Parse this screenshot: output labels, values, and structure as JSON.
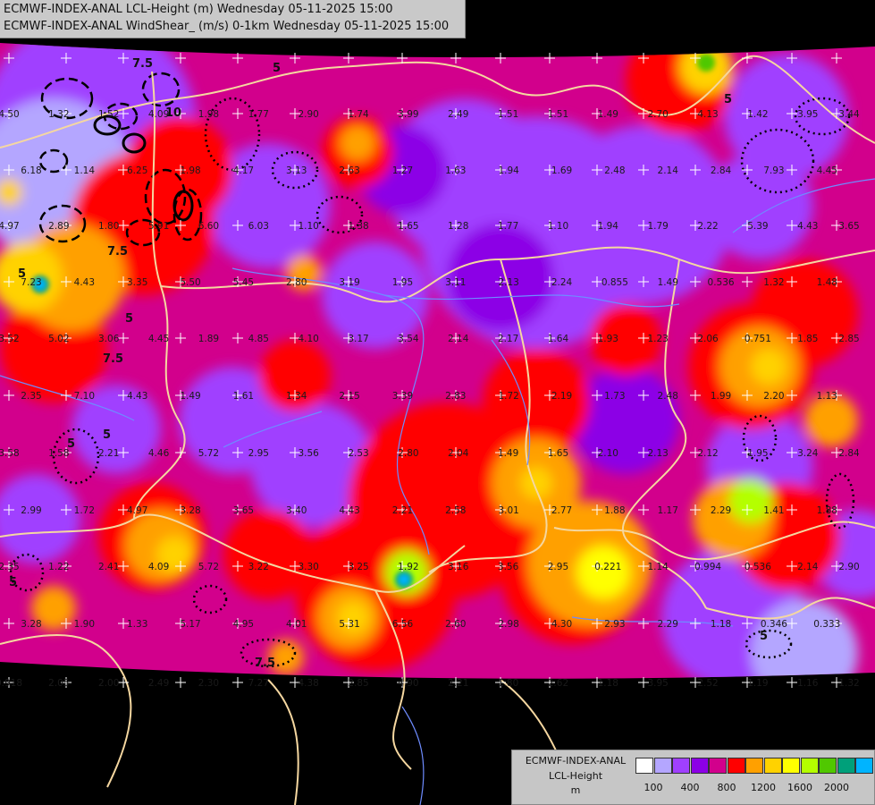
{
  "header": {
    "line1": "ECMWF-INDEX-ANAL LCL-Height (m) Wednesday 05-11-2025 15:00",
    "line2": "ECMWF-INDEX-ANAL WindShear_ (m/s) 0-1km Wednesday 05-11-2025 15:00"
  },
  "legend": {
    "title1": "ECMWF-INDEX-ANAL",
    "title2": "LCL-Height",
    "title3": "m",
    "colors": [
      "#ffffff",
      "#b4a6ff",
      "#a040ff",
      "#8c00e6",
      "#d2008c",
      "#ff0000",
      "#ffa000",
      "#ffd200",
      "#ffff00",
      "#b4ff00",
      "#50c800",
      "#00a07a",
      "#00b4ff"
    ],
    "ticks": [
      "100",
      "400",
      "800",
      "1200",
      "1600",
      "2000"
    ]
  },
  "colors": {
    "background": "#000000",
    "border_line": "#f5d7a0",
    "river": "#6e8cff",
    "title_bg": "#c9c9c9"
  },
  "map_values": [
    {
      "t": "4.50"
    },
    {
      "t": "1.32"
    },
    {
      "t": "1.52"
    },
    {
      "t": "4.09"
    },
    {
      "t": "1.98"
    },
    {
      "t": "1.77"
    },
    {
      "t": "2.90"
    },
    {
      "t": "1.74"
    },
    {
      "t": "3.99"
    },
    {
      "t": "2.49"
    },
    {
      "t": "1.51"
    },
    {
      "t": "1.51"
    },
    {
      "t": "1.49"
    },
    {
      "t": "2.70"
    },
    {
      "t": "4.13"
    },
    {
      "t": "1.42"
    },
    {
      "t": "3.95"
    },
    {
      "t": "3.44"
    },
    {
      "t": "6.18"
    },
    {
      "t": "1.14"
    },
    {
      "t": "6.25"
    },
    {
      "t": "1.98"
    },
    {
      "t": "4.17"
    },
    {
      "t": "3.13"
    },
    {
      "t": "2.63"
    },
    {
      "t": "1.27"
    },
    {
      "t": "1.63"
    },
    {
      "t": "1.94"
    },
    {
      "t": "1.69"
    },
    {
      "t": "2.48"
    },
    {
      "t": "2.14"
    },
    {
      "t": "2.84"
    },
    {
      "t": "7.93"
    },
    {
      "t": "4.45"
    },
    {
      "t": "4.97"
    },
    {
      "t": "2.89"
    },
    {
      "t": "1.80"
    },
    {
      "t": "5.91"
    },
    {
      "t": "6.60"
    },
    {
      "t": "6.03"
    },
    {
      "t": "1.10"
    },
    {
      "t": "1.38"
    },
    {
      "t": "1.65"
    },
    {
      "t": "1.28"
    },
    {
      "t": "1.77"
    },
    {
      "t": "1.10"
    },
    {
      "t": "1.94"
    },
    {
      "t": "1.79"
    },
    {
      "t": "2.22"
    },
    {
      "t": "5.39"
    },
    {
      "t": "4.43"
    },
    {
      "t": "3.65"
    },
    {
      "t": "7.23"
    },
    {
      "t": "4.43"
    },
    {
      "t": "3.35"
    },
    {
      "t": "5.50"
    },
    {
      "t": "5.45"
    },
    {
      "t": "2.80"
    },
    {
      "t": "3.19"
    },
    {
      "t": "1.95"
    },
    {
      "t": "3.11"
    },
    {
      "t": "2.13"
    },
    {
      "t": "2.24"
    },
    {
      "t": "0.855"
    },
    {
      "t": "1.49"
    },
    {
      "t": "0.536"
    },
    {
      "t": "1.32"
    },
    {
      "t": "1.48"
    },
    {
      "t": "3.52"
    },
    {
      "t": "5.02"
    },
    {
      "t": "3.06"
    },
    {
      "t": "4.45"
    },
    {
      "t": "1.89"
    },
    {
      "t": "4.85"
    },
    {
      "t": "4.10"
    },
    {
      "t": "3.17"
    },
    {
      "t": "3.54"
    },
    {
      "t": "2.14"
    },
    {
      "t": "2.17"
    },
    {
      "t": "1.64"
    },
    {
      "t": "1.93"
    },
    {
      "t": "1.23"
    },
    {
      "t": "2.06"
    },
    {
      "t": "0.751"
    },
    {
      "t": "1.85"
    },
    {
      "t": "2.85"
    },
    {
      "t": "2.35"
    },
    {
      "t": "7.10"
    },
    {
      "t": "4.43"
    },
    {
      "t": "1.49"
    },
    {
      "t": "1.61"
    },
    {
      "t": "1.34"
    },
    {
      "t": "2.15"
    },
    {
      "t": "3.39"
    },
    {
      "t": "2.83"
    },
    {
      "t": "1.72"
    },
    {
      "t": "2.19"
    },
    {
      "t": "1.73"
    },
    {
      "t": "2.48"
    },
    {
      "t": "1.99"
    },
    {
      "t": "2.20"
    },
    {
      "t": "1.13"
    },
    {
      "t": "3.58"
    },
    {
      "t": "1.58"
    },
    {
      "t": "2.21"
    },
    {
      "t": "4.46"
    },
    {
      "t": "5.72"
    },
    {
      "t": "2.95"
    },
    {
      "t": "3.56"
    },
    {
      "t": "2.53"
    },
    {
      "t": "2.80"
    },
    {
      "t": "2.04"
    },
    {
      "t": "1.49"
    },
    {
      "t": "1.65"
    },
    {
      "t": "2.10"
    },
    {
      "t": "2.13"
    },
    {
      "t": "2.12"
    },
    {
      "t": "1.95"
    },
    {
      "t": "3.24"
    },
    {
      "t": "2.84"
    },
    {
      "t": "2.99"
    },
    {
      "t": "1.72"
    },
    {
      "t": "4.97"
    },
    {
      "t": "3.28"
    },
    {
      "t": "3.65"
    },
    {
      "t": "3.40"
    },
    {
      "t": "4.43"
    },
    {
      "t": "2.21"
    },
    {
      "t": "2.58"
    },
    {
      "t": "3.01"
    },
    {
      "t": "2.77"
    },
    {
      "t": "1.88"
    },
    {
      "t": "1.17"
    },
    {
      "t": "2.29"
    },
    {
      "t": "1.41"
    },
    {
      "t": "1.88"
    },
    {
      "t": "2.35"
    },
    {
      "t": "1.22"
    },
    {
      "t": "2.41"
    },
    {
      "t": "4.09"
    },
    {
      "t": "5.72"
    },
    {
      "t": "3.22"
    },
    {
      "t": "3.30"
    },
    {
      "t": "3.25"
    },
    {
      "t": "1.92"
    },
    {
      "t": "3.16"
    },
    {
      "t": "3.56"
    },
    {
      "t": "2.95"
    },
    {
      "t": "0.221"
    },
    {
      "t": "1.14"
    },
    {
      "t": "0.994"
    },
    {
      "t": "0.536"
    },
    {
      "t": "2.14"
    },
    {
      "t": "2.90"
    },
    {
      "t": "3.28"
    },
    {
      "t": "1.90"
    },
    {
      "t": "1.33"
    },
    {
      "t": "5.17"
    },
    {
      "t": "4.95"
    },
    {
      "t": "4.01"
    },
    {
      "t": "5.31"
    },
    {
      "t": "6.56"
    },
    {
      "t": "2.60"
    },
    {
      "t": "2.98"
    },
    {
      "t": "4.30"
    },
    {
      "t": "2.93"
    },
    {
      "t": "2.29"
    },
    {
      "t": "1.18"
    },
    {
      "t": "0.346"
    },
    {
      "t": "0.333"
    },
    {
      "t": "0.918"
    },
    {
      "t": "2.05"
    },
    {
      "t": "2.00"
    },
    {
      "t": "2.49"
    },
    {
      "t": "2.30"
    },
    {
      "t": "7.27"
    },
    {
      "t": "4.38"
    },
    {
      "t": "2.85"
    },
    {
      "t": "4.90"
    },
    {
      "t": "2.21"
    },
    {
      "t": "1.80"
    },
    {
      "t": "2.62"
    },
    {
      "t": "1.18"
    },
    {
      "t": "3.95"
    },
    {
      "t": "2.52"
    },
    {
      "t": "1.19"
    },
    {
      "t": "1.16"
    },
    {
      "t": "1.32"
    },
    {
      "t": "4.51"
    },
    {
      "t": "2.12"
    },
    {
      "t": "4.57"
    },
    {
      "t": "0.47"
    },
    {
      "t": "1.71"
    }
  ],
  "contour_labels": [
    "7.5",
    "10",
    "7.5",
    "5",
    "5",
    "5",
    "7.5",
    "5",
    "5",
    "5",
    "7.5",
    "5",
    "5"
  ]
}
